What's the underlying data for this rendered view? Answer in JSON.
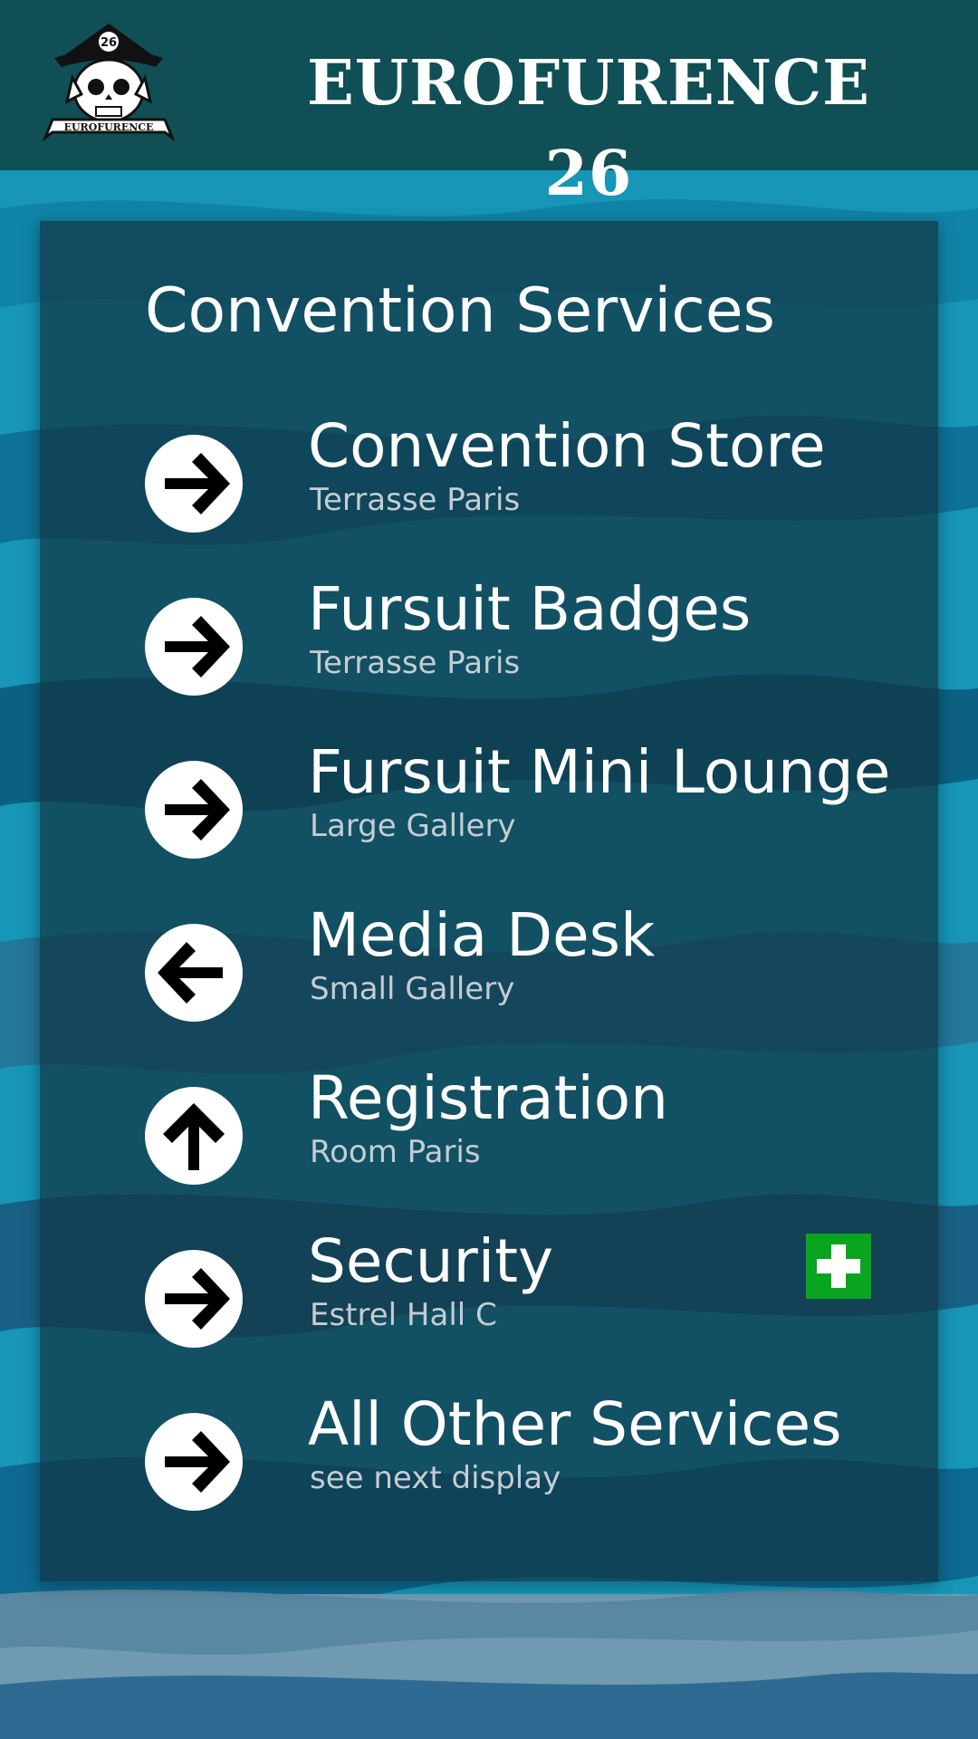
{
  "header": {
    "title": "EUROFURENCE 26",
    "logo": {
      "icon": "eurofurence-pirate-skull-logo",
      "badge_number": "26",
      "banner_text": "EUROFURENCE"
    },
    "background_color": "#0f4f55"
  },
  "panel": {
    "title": "Convention Services"
  },
  "services": [
    {
      "name": "Convention Store",
      "location": "Terrasse Paris",
      "arrow": "right-arrow-icon"
    },
    {
      "name": "Fursuit Badges",
      "location": "Terrasse Paris",
      "arrow": "right-arrow-icon"
    },
    {
      "name": "Fursuit Mini Lounge",
      "location": "Large Gallery",
      "arrow": "right-arrow-icon"
    },
    {
      "name": "Media Desk",
      "location": "Small Gallery",
      "arrow": "left-arrow-icon"
    },
    {
      "name": "Registration",
      "location": "Room Paris",
      "arrow": "up-arrow-icon"
    },
    {
      "name": "Security",
      "location": "Estrel Hall C",
      "arrow": "right-arrow-icon",
      "badge": "first-aid-cross-icon"
    },
    {
      "name": "All Other Services",
      "location": "see next display",
      "arrow": "right-arrow-icon"
    }
  ],
  "colors": {
    "panel": "#10344a",
    "text": "#ffffff",
    "subtext": "#c4cdd2",
    "first_aid": "#0aa51e"
  }
}
